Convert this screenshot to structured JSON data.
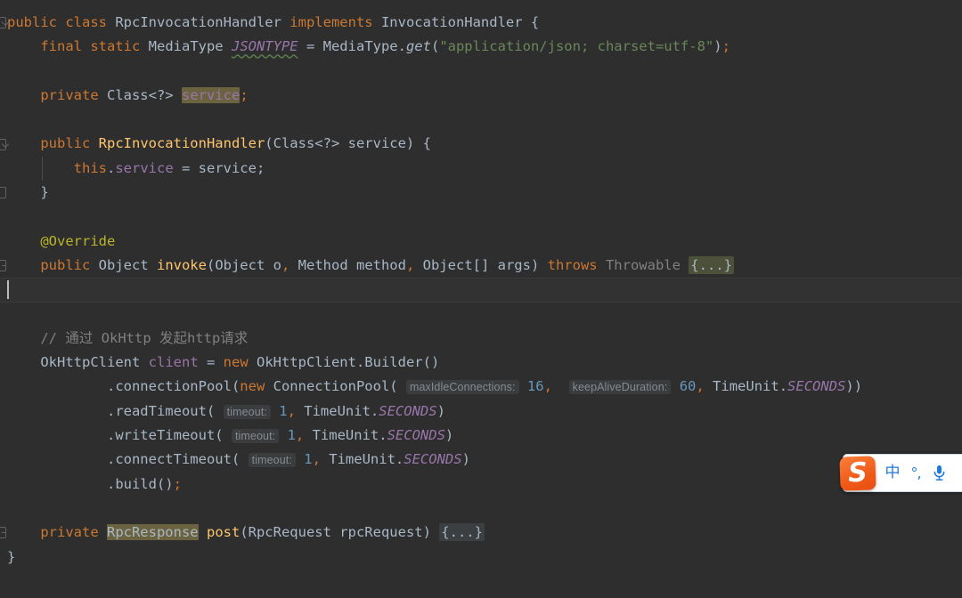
{
  "editor": {
    "theme_background": "#2e2e2e",
    "current_line_background": "#323232",
    "caret_color": "#bbbbbb",
    "occurrence_highlight": "#6b6340",
    "lines": [
      {
        "n": 1,
        "fold": "expanded",
        "tokens": [
          {
            "t": "public ",
            "c": "kw"
          },
          {
            "t": "class ",
            "c": "kw"
          },
          {
            "t": "RpcInvocationHandler ",
            "c": "txt"
          },
          {
            "t": "implements ",
            "c": "kw"
          },
          {
            "t": "InvocationHandler {",
            "c": "txt"
          }
        ]
      },
      {
        "n": 2,
        "tokens": [
          {
            "t": "    ",
            "c": "txt"
          },
          {
            "t": "final ",
            "c": "kw"
          },
          {
            "t": "static ",
            "c": "kw"
          },
          {
            "t": "MediaType ",
            "c": "txt"
          },
          {
            "t": "JSONTYPE",
            "c": "stat wavy"
          },
          {
            "t": " = MediaType.",
            "c": "txt"
          },
          {
            "t": "get",
            "c": "txt italic"
          },
          {
            "t": "(",
            "c": "txt"
          },
          {
            "t": "\"application/json; charset=utf-8\"",
            "c": "str"
          },
          {
            "t": ")",
            "c": "txt"
          },
          {
            "t": ";",
            "c": "kw"
          }
        ]
      },
      {
        "n": 3,
        "tokens": []
      },
      {
        "n": 4,
        "tokens": [
          {
            "t": "    ",
            "c": "txt"
          },
          {
            "t": "private ",
            "c": "kw"
          },
          {
            "t": "Class<?> ",
            "c": "txt"
          },
          {
            "t": "service",
            "c": "fld occ"
          },
          {
            "t": ";",
            "c": "kw"
          }
        ]
      },
      {
        "n": 5,
        "tokens": []
      },
      {
        "n": 6,
        "fold": "expanded",
        "tokens": [
          {
            "t": "    ",
            "c": "txt"
          },
          {
            "t": "public ",
            "c": "kw"
          },
          {
            "t": "RpcInvocationHandler",
            "c": "meth"
          },
          {
            "t": "(Class<?> service) {",
            "c": "txt"
          }
        ]
      },
      {
        "n": 7,
        "tokens": [
          {
            "t": "        ",
            "c": "txt"
          },
          {
            "t": "this",
            "c": "kw"
          },
          {
            "t": ".",
            "c": "txt"
          },
          {
            "t": "service",
            "c": "fld"
          },
          {
            "t": " = service;",
            "c": "txt"
          }
        ]
      },
      {
        "n": 8,
        "fold": "end",
        "tokens": [
          {
            "t": "    }",
            "c": "txt"
          }
        ]
      },
      {
        "n": 9,
        "tokens": []
      },
      {
        "n": 10,
        "tokens": [
          {
            "t": "    ",
            "c": "txt"
          },
          {
            "t": "@Override",
            "c": "anno"
          }
        ]
      },
      {
        "n": 11,
        "fold": "collapsed",
        "tokens": [
          {
            "t": "    ",
            "c": "txt"
          },
          {
            "t": "public ",
            "c": "kw"
          },
          {
            "t": "Object ",
            "c": "txt"
          },
          {
            "t": "invoke",
            "c": "meth"
          },
          {
            "t": "(Object o",
            "c": "txt"
          },
          {
            "t": ",",
            "c": "kw"
          },
          {
            "t": " Method method",
            "c": "txt"
          },
          {
            "t": ",",
            "c": "kw"
          },
          {
            "t": " Object[] args) ",
            "c": "txt"
          },
          {
            "t": "throws ",
            "c": "kw"
          },
          {
            "t": "Throwable ",
            "c": "dim"
          },
          {
            "t": "{...}",
            "c": "folded"
          }
        ]
      },
      {
        "n": 12,
        "current": true,
        "caret": true,
        "tokens": []
      },
      {
        "n": 13,
        "tokens": []
      },
      {
        "n": 14,
        "tokens": [
          {
            "t": "    ",
            "c": "txt"
          },
          {
            "t": "// 通过 OkHttp 发起http请求",
            "c": "cmt"
          }
        ]
      },
      {
        "n": 15,
        "tokens": [
          {
            "t": "    ",
            "c": "txt"
          },
          {
            "t": "OkHttpClient ",
            "c": "txt"
          },
          {
            "t": "client",
            "c": "fld"
          },
          {
            "t": " = ",
            "c": "txt"
          },
          {
            "t": "new ",
            "c": "kw"
          },
          {
            "t": "OkHttpClient.Builder()",
            "c": "txt"
          }
        ]
      },
      {
        "n": 16,
        "tokens": [
          {
            "t": "            .connectionPool(",
            "c": "txt"
          },
          {
            "t": "new ",
            "c": "kw"
          },
          {
            "t": "ConnectionPool( ",
            "c": "txt"
          },
          {
            "t": "maxIdleConnections:",
            "c": "hint"
          },
          {
            "t": " ",
            "c": "txt"
          },
          {
            "t": "16",
            "c": "num"
          },
          {
            "t": ",",
            "c": "kw"
          },
          {
            "t": "  ",
            "c": "txt"
          },
          {
            "t": "keepAliveDuration:",
            "c": "hint"
          },
          {
            "t": " ",
            "c": "txt"
          },
          {
            "t": "60",
            "c": "num"
          },
          {
            "t": ",",
            "c": "kw"
          },
          {
            "t": " TimeUnit.",
            "c": "txt"
          },
          {
            "t": "SECONDS",
            "c": "stat"
          },
          {
            "t": "))",
            "c": "txt"
          }
        ]
      },
      {
        "n": 17,
        "tokens": [
          {
            "t": "            .readTimeout( ",
            "c": "txt"
          },
          {
            "t": "timeout:",
            "c": "hint"
          },
          {
            "t": " ",
            "c": "txt"
          },
          {
            "t": "1",
            "c": "num"
          },
          {
            "t": ",",
            "c": "kw"
          },
          {
            "t": " TimeUnit.",
            "c": "txt"
          },
          {
            "t": "SECONDS",
            "c": "stat"
          },
          {
            "t": ")",
            "c": "txt"
          }
        ]
      },
      {
        "n": 18,
        "tokens": [
          {
            "t": "            .writeTimeout( ",
            "c": "txt"
          },
          {
            "t": "timeout:",
            "c": "hint"
          },
          {
            "t": " ",
            "c": "txt"
          },
          {
            "t": "1",
            "c": "num"
          },
          {
            "t": ",",
            "c": "kw"
          },
          {
            "t": " TimeUnit.",
            "c": "txt"
          },
          {
            "t": "SECONDS",
            "c": "stat"
          },
          {
            "t": ")",
            "c": "txt"
          }
        ]
      },
      {
        "n": 19,
        "tokens": [
          {
            "t": "            .connectTimeout( ",
            "c": "txt"
          },
          {
            "t": "timeout:",
            "c": "hint"
          },
          {
            "t": " ",
            "c": "txt"
          },
          {
            "t": "1",
            "c": "num"
          },
          {
            "t": ",",
            "c": "kw"
          },
          {
            "t": " TimeUnit.",
            "c": "txt"
          },
          {
            "t": "SECONDS",
            "c": "stat"
          },
          {
            "t": ")",
            "c": "txt"
          }
        ]
      },
      {
        "n": 20,
        "tokens": [
          {
            "t": "            .build()",
            "c": "txt"
          },
          {
            "t": ";",
            "c": "kw"
          }
        ]
      },
      {
        "n": 21,
        "tokens": []
      },
      {
        "n": 22,
        "fold": "collapsed",
        "tokens": [
          {
            "t": "    ",
            "c": "txt"
          },
          {
            "t": "private ",
            "c": "kw"
          },
          {
            "t": "RpcResponse",
            "c": "txt occ"
          },
          {
            "t": " ",
            "c": "txt"
          },
          {
            "t": "post",
            "c": "meth"
          },
          {
            "t": "(RpcRequest rpcRequest) ",
            "c": "txt"
          },
          {
            "t": "{...}",
            "c": "folded grey"
          }
        ]
      },
      {
        "n": 23,
        "tokens": [
          {
            "t": "}",
            "c": "txt"
          }
        ]
      }
    ]
  },
  "ime": {
    "name": "sogou-input-method",
    "logo_letter": "S",
    "logo_color": "#f05a18",
    "accent_color": "#1f7ae0",
    "mode_label": "中",
    "punctuation_label": "°,",
    "voice_icon": "microphone-icon"
  }
}
